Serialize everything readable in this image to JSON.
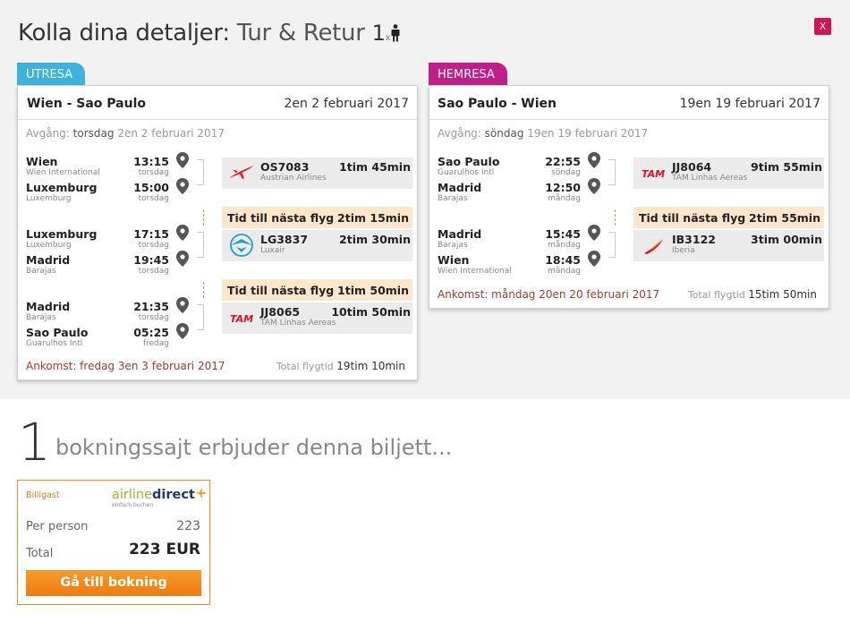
{
  "header": {
    "title": "Kolla dina detaljer:",
    "trip_type": "Tur & Retur",
    "passengers": "1",
    "pax_sep": "x",
    "close_label": "X"
  },
  "colors": {
    "outbound_tab": "#3bb3dc",
    "return_tab": "#c11e8a",
    "close": "#d0145a",
    "layover_bg": "#fde6cc",
    "book_button": "#f08c1e",
    "arrival_text": "#a23c2a"
  },
  "outbound": {
    "tab_label": "UTRESA",
    "route": "Wien - Sao Paulo",
    "date": "2en 2 februari 2017",
    "departure_label": "Avgång:",
    "departure_day": "torsdag",
    "departure_date": "2en 2 februari 2017",
    "legs": [
      {
        "from_city": "Wien",
        "from_airport": "Wien International",
        "dep_time": "13:15",
        "dep_day": "torsdag",
        "to_city": "Luxemburg",
        "to_airport": "Luxemburg",
        "arr_time": "15:00",
        "arr_day": "torsdag",
        "flight_no": "OS7083",
        "airline": "Austrian Airlines",
        "duration": "1tim 45min",
        "logo": "austrian-logo"
      },
      {
        "from_city": "Luxemburg",
        "from_airport": "Luxemburg",
        "dep_time": "17:15",
        "dep_day": "torsdag",
        "to_city": "Madrid",
        "to_airport": "Barajas",
        "arr_time": "19:45",
        "arr_day": "torsdag",
        "flight_no": "LG3837",
        "airline": "Luxair",
        "duration": "2tim 30min",
        "logo": "luxair-logo"
      },
      {
        "from_city": "Madrid",
        "from_airport": "Barajas",
        "dep_time": "21:35",
        "dep_day": "torsdag",
        "to_city": "Sao Paulo",
        "to_airport": "Guarulhos Intl",
        "arr_time": "05:25",
        "arr_day": "fredag",
        "flight_no": "JJ8065",
        "airline": "TAM Linhas Aereas",
        "duration": "10tim 50min",
        "logo": "tam-logo"
      }
    ],
    "layovers": [
      {
        "label": "Tid till nästa flyg",
        "duration": "2tim 15min"
      },
      {
        "label": "Tid till nästa flyg",
        "duration": "1tim 50min"
      }
    ],
    "arrival": "Ankomst: fredag 3en 3 februari 2017",
    "total_label": "Total flygtid",
    "total": "19tim 10min"
  },
  "return": {
    "tab_label": "HEMRESA",
    "route": "Sao Paulo - Wien",
    "date": "19en 19 februari 2017",
    "departure_label": "Avgång:",
    "departure_day": "söndag",
    "departure_date": "19en 19 februari 2017",
    "legs": [
      {
        "from_city": "Sao Paulo",
        "from_airport": "Guarulhos Intl",
        "dep_time": "22:55",
        "dep_day": "söndag",
        "to_city": "Madrid",
        "to_airport": "Barajas",
        "arr_time": "12:50",
        "arr_day": "måndag",
        "flight_no": "JJ8064",
        "airline": "TAM Linhas Aereas",
        "duration": "9tim 55min",
        "logo": "tam-logo"
      },
      {
        "from_city": "Madrid",
        "from_airport": "Barajas",
        "dep_time": "15:45",
        "dep_day": "måndag",
        "to_city": "Wien",
        "to_airport": "Wien International",
        "arr_time": "18:45",
        "arr_day": "måndag",
        "flight_no": "IB3122",
        "airline": "Iberia",
        "duration": "3tim 00min",
        "logo": "iberia-logo"
      }
    ],
    "layovers": [
      {
        "label": "Tid till nästa flyg",
        "duration": "2tim 55min"
      }
    ],
    "arrival": "Ankomst: måndag 20en 20 februari 2017",
    "total_label": "Total flygtid",
    "total": "15tim 50min"
  },
  "offers": {
    "count": "1",
    "text": "bokningssajt erbjuder denna biljett...",
    "items": [
      {
        "badge": "Billigast",
        "brand_part1": "airline",
        "brand_part2": "direct",
        "brand_tagline": "einfach buchen",
        "per_person_label": "Per person",
        "per_person": "223",
        "total_label": "Total",
        "total": "223 EUR",
        "button": "Gå till bokning"
      }
    ]
  }
}
